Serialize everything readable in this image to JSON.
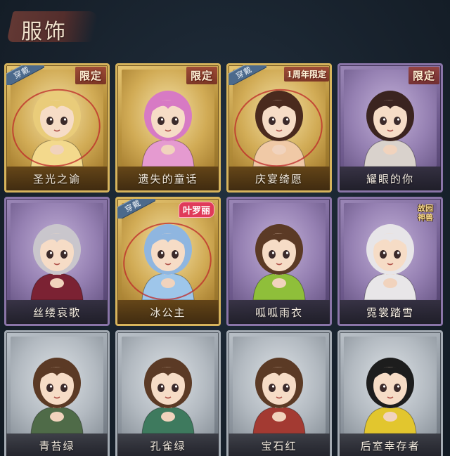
{
  "header": {
    "title": "服饰"
  },
  "badges": {
    "equipped": "穿戴"
  },
  "cards": [
    {
      "name": "圣光之谕",
      "tier": "gold",
      "equipped": true,
      "tag": "限定",
      "tag_type": "limited",
      "accent": "#f3d98c",
      "hair": "#e9cc7a"
    },
    {
      "name": "遗失的童话",
      "tier": "gold",
      "equipped": false,
      "tag": "限定",
      "tag_type": "limited",
      "accent": "#e59ad0",
      "hair": "#d77ac4"
    },
    {
      "name": "庆宴绮愿",
      "tier": "gold",
      "equipped": true,
      "tag": "1周年限定",
      "tag_type": "anniv",
      "accent": "#f0c9a6",
      "hair": "#4a2a1e"
    },
    {
      "name": "耀眼的你",
      "tier": "purple",
      "equipped": false,
      "tag": "限定",
      "tag_type": "limited",
      "accent": "#d9d2cc",
      "hair": "#3b2420"
    },
    {
      "name": "丝缕哀歌",
      "tier": "purple",
      "equipped": false,
      "tag": "",
      "tag_type": "none",
      "accent": "#7b2233",
      "hair": "#c9c6cc"
    },
    {
      "name": "冰公主",
      "tier": "gold",
      "equipped": true,
      "tag": "叶罗丽",
      "tag_type": "collab",
      "accent": "#9ec6ea",
      "hair": "#8fb6e0"
    },
    {
      "name": "呱呱雨衣",
      "tier": "purple",
      "equipped": false,
      "tag": "",
      "tag_type": "none",
      "accent": "#8fbf3a",
      "hair": "#5b3a25"
    },
    {
      "name": "霓裳踏雪",
      "tier": "purple",
      "equipped": false,
      "tag": "故园神兽",
      "tag_type": "mythic",
      "accent": "#e8e6e8",
      "hair": "#e7e5e8"
    },
    {
      "name": "青苔绿",
      "tier": "gray",
      "equipped": false,
      "tag": "",
      "tag_type": "none",
      "accent": "#4f6b48",
      "hair": "#5b3a25"
    },
    {
      "name": "孔雀绿",
      "tier": "gray",
      "equipped": false,
      "tag": "",
      "tag_type": "none",
      "accent": "#3e7a5e",
      "hair": "#5b3a25"
    },
    {
      "name": "宝石红",
      "tier": "gray",
      "equipped": false,
      "tag": "",
      "tag_type": "none",
      "accent": "#a33a32",
      "hair": "#5b3a25"
    },
    {
      "name": "后室幸存者",
      "tier": "gray",
      "equipped": false,
      "tag": "",
      "tag_type": "none",
      "accent": "#e2c62e",
      "hair": "#1d1d1d"
    }
  ]
}
